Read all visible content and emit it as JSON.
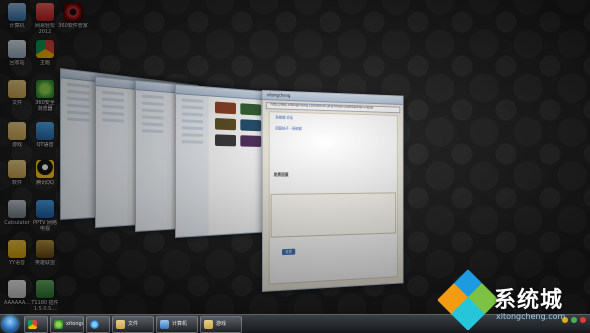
{
  "desktop": {
    "icons_left": [
      {
        "label": "计算机",
        "icon": "computer-icon"
      },
      {
        "label": "回收站",
        "icon": "recycle-bin-icon"
      },
      {
        "label": "文件",
        "icon": "folder-icon"
      },
      {
        "label": "游戏",
        "icon": "folder-icon"
      },
      {
        "label": "软件",
        "icon": "folder-icon"
      },
      {
        "label": "Calculator",
        "icon": "calculator-icon"
      },
      {
        "label": "YY语音",
        "icon": "yy-icon"
      },
      {
        "label": "AAAAAA...",
        "icon": "file-icon"
      }
    ],
    "icons_mid": [
      {
        "label": "网易轻松\n2012",
        "icon": "music-icon"
      },
      {
        "label": "主题",
        "icon": "chrome-icon"
      },
      {
        "label": "360安全\n浏览器",
        "icon": "browser-360-icon"
      },
      {
        "label": "QT语音",
        "icon": "qt-icon"
      },
      {
        "label": "腾讯QQ",
        "icon": "qq-icon"
      },
      {
        "label": "PPTV 网络\n电视",
        "icon": "pptv-icon"
      },
      {
        "label": "英雄联盟",
        "icon": "lol-icon"
      },
      {
        "label": "T1180 插件\n1.5.0.S...",
        "icon": "exe-icon"
      }
    ],
    "icon_top": {
      "label": "360软件管家",
      "icon": "eye-icon"
    }
  },
  "flip3d": {
    "front_window": {
      "title": "xitongcheng",
      "address": "http://bbs.xitongcheng.com/forum.php?mod=post&action=reply",
      "section_title": "发表回复",
      "links": [
        "系统城 论坛",
        "回复帖子 - 系统城"
      ],
      "submit_label": "发表"
    }
  },
  "taskbar": {
    "buttons": [
      {
        "label": "",
        "icon": "chrome-icon"
      },
      {
        "label": "xitongcheng",
        "icon": "browser-360-icon"
      },
      {
        "label": "",
        "icon": "ie-icon"
      },
      {
        "label": "文件",
        "icon": "folder-icon"
      },
      {
        "label": "计算机",
        "icon": "computer-icon"
      },
      {
        "label": "游戏",
        "icon": "folder-icon"
      }
    ],
    "time": ""
  },
  "watermark": {
    "brand": "系统城",
    "url": "xitongcheng.com"
  },
  "colors": {
    "accent": "#1a5aa8",
    "diamond_blue": "#1e9be0",
    "diamond_green": "#7dc242",
    "diamond_orange": "#f39c12",
    "diamond_cyan": "#26c6da"
  }
}
